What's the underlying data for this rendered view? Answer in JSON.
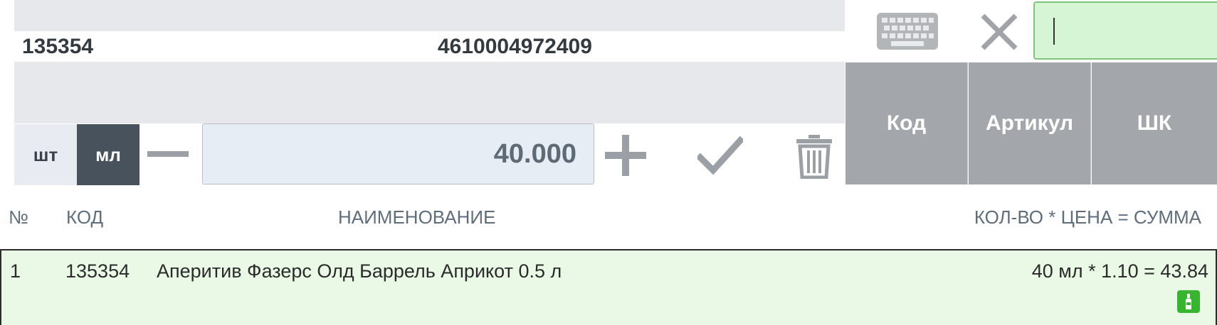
{
  "product": {
    "code": "135354",
    "barcode": "4610004972409"
  },
  "quantity": {
    "units": [
      "шт",
      "мл"
    ],
    "selected_unit": "мл",
    "value": "40.000"
  },
  "search": {
    "value": "",
    "placeholder": ""
  },
  "mode_buttons": [
    "Код",
    "Артикул",
    "ШК"
  ],
  "table": {
    "headers": {
      "num": "№",
      "code": "КОД",
      "name": "НАИМЕНОВАНИЕ",
      "qty_price_sum": "КОЛ-ВО * ЦЕНА = СУММА"
    },
    "rows": [
      {
        "num": "1",
        "code": "135354",
        "name": "Аперитив Фазерс Олд Баррель Априкот 0.5 л",
        "calc": "40 мл * 1.10 = 43.84"
      }
    ]
  },
  "icons": {
    "keyboard": "keyboard-icon",
    "close": "close-icon",
    "minus": "minus-icon",
    "plus": "plus-icon",
    "check": "check-icon",
    "trash": "trash-icon",
    "row_badge": "bottle-icon"
  },
  "colors": {
    "accent_green": "#38b52f",
    "selected_row_bg": "#eaf8e6",
    "search_bg": "#d6f5d4",
    "mode_button_bg": "#a3a7ab",
    "unit_selected_bg": "#47525c"
  }
}
